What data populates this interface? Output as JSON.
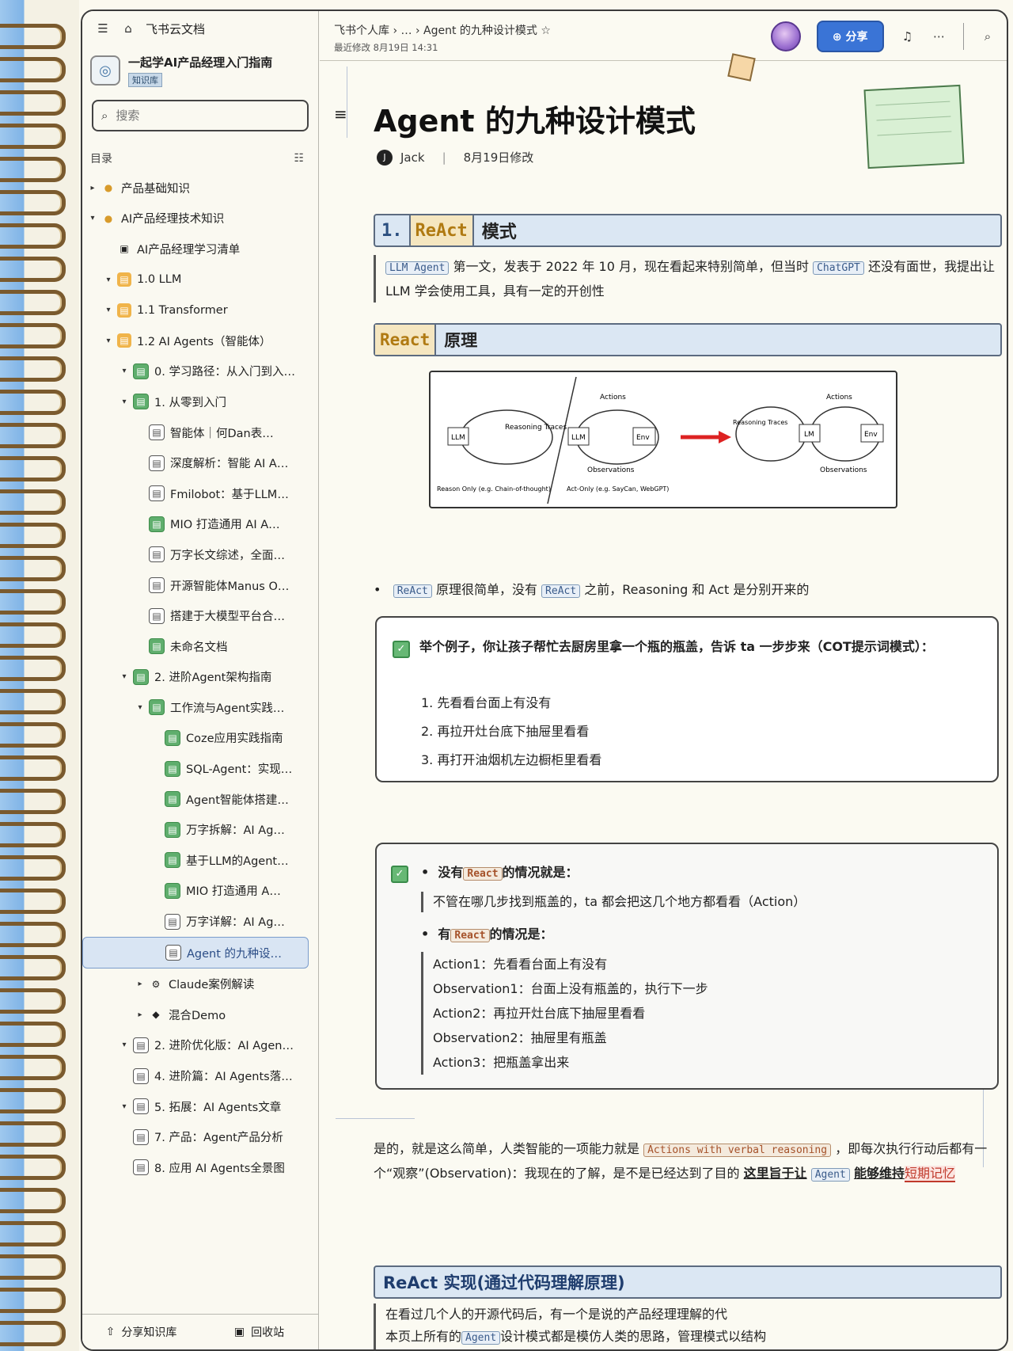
{
  "sidebar": {
    "app_title": "飞书云文档",
    "kb_title": "一起学AI产品经理入门指南",
    "kb_badge": "知识库",
    "search_placeholder": "搜索",
    "toc_label": "目录",
    "tree": [
      {
        "label": "产品基础知识",
        "level": 0,
        "icon": "folder",
        "arrow": "▸"
      },
      {
        "label": "AI产品经理技术知识",
        "level": 0,
        "icon": "folder",
        "arrow": "▾"
      },
      {
        "label": "AI产品经理学习清单",
        "level": 1,
        "icon": "save",
        "arrow": ""
      },
      {
        "label": "1.0 LLM",
        "level": 1,
        "icon": "orange",
        "arrow": "▾"
      },
      {
        "label": "1.1 Transformer",
        "level": 1,
        "icon": "orange",
        "arrow": "▾"
      },
      {
        "label": "1.2 AI Agents（智能体）",
        "level": 1,
        "icon": "orange",
        "arrow": "▾"
      },
      {
        "label": "0. 学习路径：从入门到入…",
        "level": 2,
        "icon": "green",
        "arrow": "▾"
      },
      {
        "label": "1. 从零到入门",
        "level": 2,
        "icon": "green",
        "arrow": "▾"
      },
      {
        "label": "智能体｜何Dan表…",
        "level": 3,
        "icon": "doc",
        "arrow": ""
      },
      {
        "label": "深度解析：智能 AI A…",
        "level": 3,
        "icon": "doc",
        "arrow": ""
      },
      {
        "label": "Fmilobot：基于LLM…",
        "level": 3,
        "icon": "doc",
        "arrow": ""
      },
      {
        "label": "MIO 打造通用 AI A…",
        "level": 3,
        "icon": "green",
        "arrow": ""
      },
      {
        "label": "万字长文综述，全面…",
        "level": 3,
        "icon": "doc",
        "arrow": ""
      },
      {
        "label": "开源智能体Manus O…",
        "level": 3,
        "icon": "doc",
        "arrow": ""
      },
      {
        "label": "搭建于大模型平台合…",
        "level": 3,
        "icon": "doc",
        "arrow": ""
      },
      {
        "label": "未命名文档",
        "level": 3,
        "icon": "green",
        "arrow": ""
      },
      {
        "label": "2. 进阶Agent架构指南",
        "level": 2,
        "icon": "green",
        "arrow": "▾"
      },
      {
        "label": "工作流与Agent实践…",
        "level": 3,
        "icon": "green",
        "arrow": "▾"
      },
      {
        "label": "Coze应用实践指南",
        "level": 4,
        "icon": "green",
        "arrow": ""
      },
      {
        "label": "SQL-Agent：实现…",
        "level": 4,
        "icon": "green",
        "arrow": ""
      },
      {
        "label": "Agent智能体搭建…",
        "level": 4,
        "icon": "green",
        "arrow": ""
      },
      {
        "label": "万字拆解：AI Ag…",
        "level": 4,
        "icon": "green",
        "arrow": ""
      },
      {
        "label": "基于LLM的Agent…",
        "level": 4,
        "icon": "green",
        "arrow": ""
      },
      {
        "label": "MIO 打造通用 A…",
        "level": 4,
        "icon": "green",
        "arrow": ""
      },
      {
        "label": "万字详解：AI Ag…",
        "level": 4,
        "icon": "doc",
        "arrow": ""
      },
      {
        "label": "Agent 的九种设…",
        "level": 4,
        "icon": "doc",
        "arrow": "",
        "selected": true
      },
      {
        "label": "Claude案例解读",
        "level": 3,
        "icon": "gear",
        "arrow": "▸"
      },
      {
        "label": "混合Demo",
        "level": 3,
        "icon": "diamond",
        "arrow": "▸"
      },
      {
        "label": "2. 进阶优化版：AI Agen…",
        "level": 2,
        "icon": "doc",
        "arrow": "▾"
      },
      {
        "label": "4. 进阶篇：AI Agents落…",
        "level": 2,
        "icon": "doc",
        "arrow": ""
      },
      {
        "label": "5. 拓展：AI Agents文章",
        "level": 2,
        "icon": "doc",
        "arrow": "▾"
      },
      {
        "label": "7. 产品：Agent产品分析",
        "level": 2,
        "icon": "doc",
        "arrow": ""
      },
      {
        "label": "8. 应用 AI Agents全景图",
        "level": 2,
        "icon": "doc",
        "arrow": ""
      }
    ],
    "bottom_left": "分享知识库",
    "bottom_right": "回收站"
  },
  "topbar": {
    "breadcrumb": [
      "飞书个人库",
      "…",
      "Agent 的九种设计模式"
    ],
    "subcrumb": "最近修改 8月19日 14:31",
    "share_label": "分享"
  },
  "doc": {
    "title": "Agent 的九种设计模式",
    "author": "Jack",
    "modified": "8月19日修改",
    "s1_num": "1.",
    "s1_tag": "ReAct",
    "s1_text": "模式",
    "p1_code1": "LLM Agent",
    "p1_text1": "第一文，发表于 2022 年 10 月，现在看起来特别简单，但当时",
    "p1_code2": "ChatGPT",
    "p1_text2": "还没有面世，我提出让 LLM 学会使用工具，具有一定的开创性",
    "s2_tag": "React",
    "s2_text": "原理",
    "diagram": {
      "left_label": "LLM",
      "left_right": "Reasoning Traces",
      "left_caption": "Reason Only (e.g. Chain-of-thought)",
      "mid_top": "Actions",
      "mid_l": "LLM",
      "mid_r": "Env",
      "mid_bottom": "Observations",
      "mid_caption": "Act-Only (e.g. SayCan, WebGPT)",
      "right_top": "Actions",
      "right_reason": "Reasoning Traces",
      "right_l": "LM",
      "right_r": "Env",
      "right_bottom": "Observations"
    },
    "bullet_code1": "ReAct",
    "bullet_text1": "原理很简单，没有",
    "bullet_code2": "ReAct",
    "bullet_text2": "之前，Reasoning 和 Act 是分别开来的",
    "callout1_title": "举个例子，你让孩子帮忙去厨房里拿一个瓶的瓶盖，告诉 ta 一步步来（COT提示词模式）：",
    "callout1_items": [
      "1. 先看看台面上有没有",
      "2. 再拉开灶台底下抽屉里看看",
      "3. 再打开油烟机左边橱柜里看看"
    ],
    "c2_b1_pre": "没有",
    "c2_b1_code": "React",
    "c2_b1_post": "的情况就是：",
    "c2_q1": "不管在哪几步找到瓶盖的，ta 都会把这几个地方都看看（Action）",
    "c2_b2_pre": "有",
    "c2_b2_code": "React",
    "c2_b2_post": "的情况是：",
    "c2_lines": [
      "Action1：先看看台面上有没有",
      "Observation1：台面上没有瓶盖的，执行下一步",
      "Action2：再拉开灶台底下抽屉里看看",
      "Observation2：抽屉里有瓶盖",
      "Action3：把瓶盖拿出来"
    ],
    "p3_text1": "是的，就是这么简单，人类智能的一项能力就是",
    "p3_code": "Actions with verbal reasoning",
    "p3_text2": "，即每次执行行动后都有一个“观察”(Observation)：我现在的了解，是不是已经达到了目的",
    "p3_under": "这里旨于让",
    "p3_code2": "Agent",
    "p3_bold": "能够维持",
    "p3_red": "短期记忆",
    "s3_text": "ReAct 实现(通过代码理解原理)",
    "p4_line1": "在看过几个人的开源代码后，有一个是说的产品经理理解的代",
    "p4_line2a": "本页上所有的",
    "p4_code": "Agent",
    "p4_line2b": "设计模式都是模仿人类的思路，管理模式以结构"
  },
  "colors": {
    "accent": "#3a74d6",
    "tag_bg": "#f5e6c0",
    "h2_bg": "#dbe7f3"
  }
}
